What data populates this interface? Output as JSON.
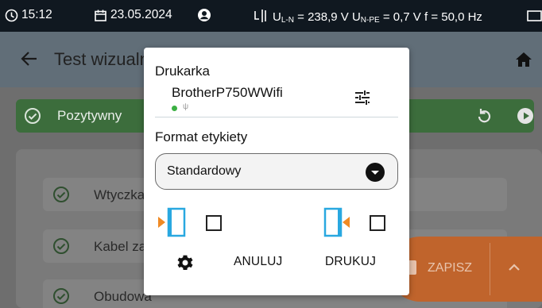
{
  "status_bar": {
    "time": "15:12",
    "date": "23.05.2024",
    "measurement_prefix": "U",
    "measurement_sub1": "L-N",
    "measurement_mid": "= 238,9 V U",
    "measurement_sub2": "N-PE",
    "measurement_end": "= 0,7 V f = 50,0 Hz"
  },
  "app_bar": {
    "title": "Test wizualny"
  },
  "result": {
    "label": "Pozytywny"
  },
  "items": [
    {
      "label": "Wtyczka"
    },
    {
      "label": "Kabel zasilający"
    },
    {
      "label": "Obudowa"
    }
  ],
  "save_button": {
    "label": "ZAPISZ"
  },
  "dialog": {
    "printer_label": "Drukarka",
    "printer_name": "BrotherP750WWifi",
    "connection_symbol": "ψ",
    "format_label": "Format etykiety",
    "format_value": "Standardowy",
    "cancel_label": "ANULUJ",
    "print_label": "DRUKUJ"
  },
  "colors": {
    "accent_orange": "#f08a24",
    "accent_blue": "#29a8e0",
    "status_green": "#3cb043"
  },
  "icons": [
    "clock-icon",
    "calendar-icon",
    "user-icon",
    "phase-icon",
    "battery-icon",
    "back-arrow-icon",
    "home-icon",
    "tune-icon",
    "dropdown-icon",
    "label-left-icon",
    "label-right-icon",
    "gear-icon",
    "reset-icon",
    "play-icon",
    "check-circle-icon",
    "chevron-up-icon"
  ]
}
